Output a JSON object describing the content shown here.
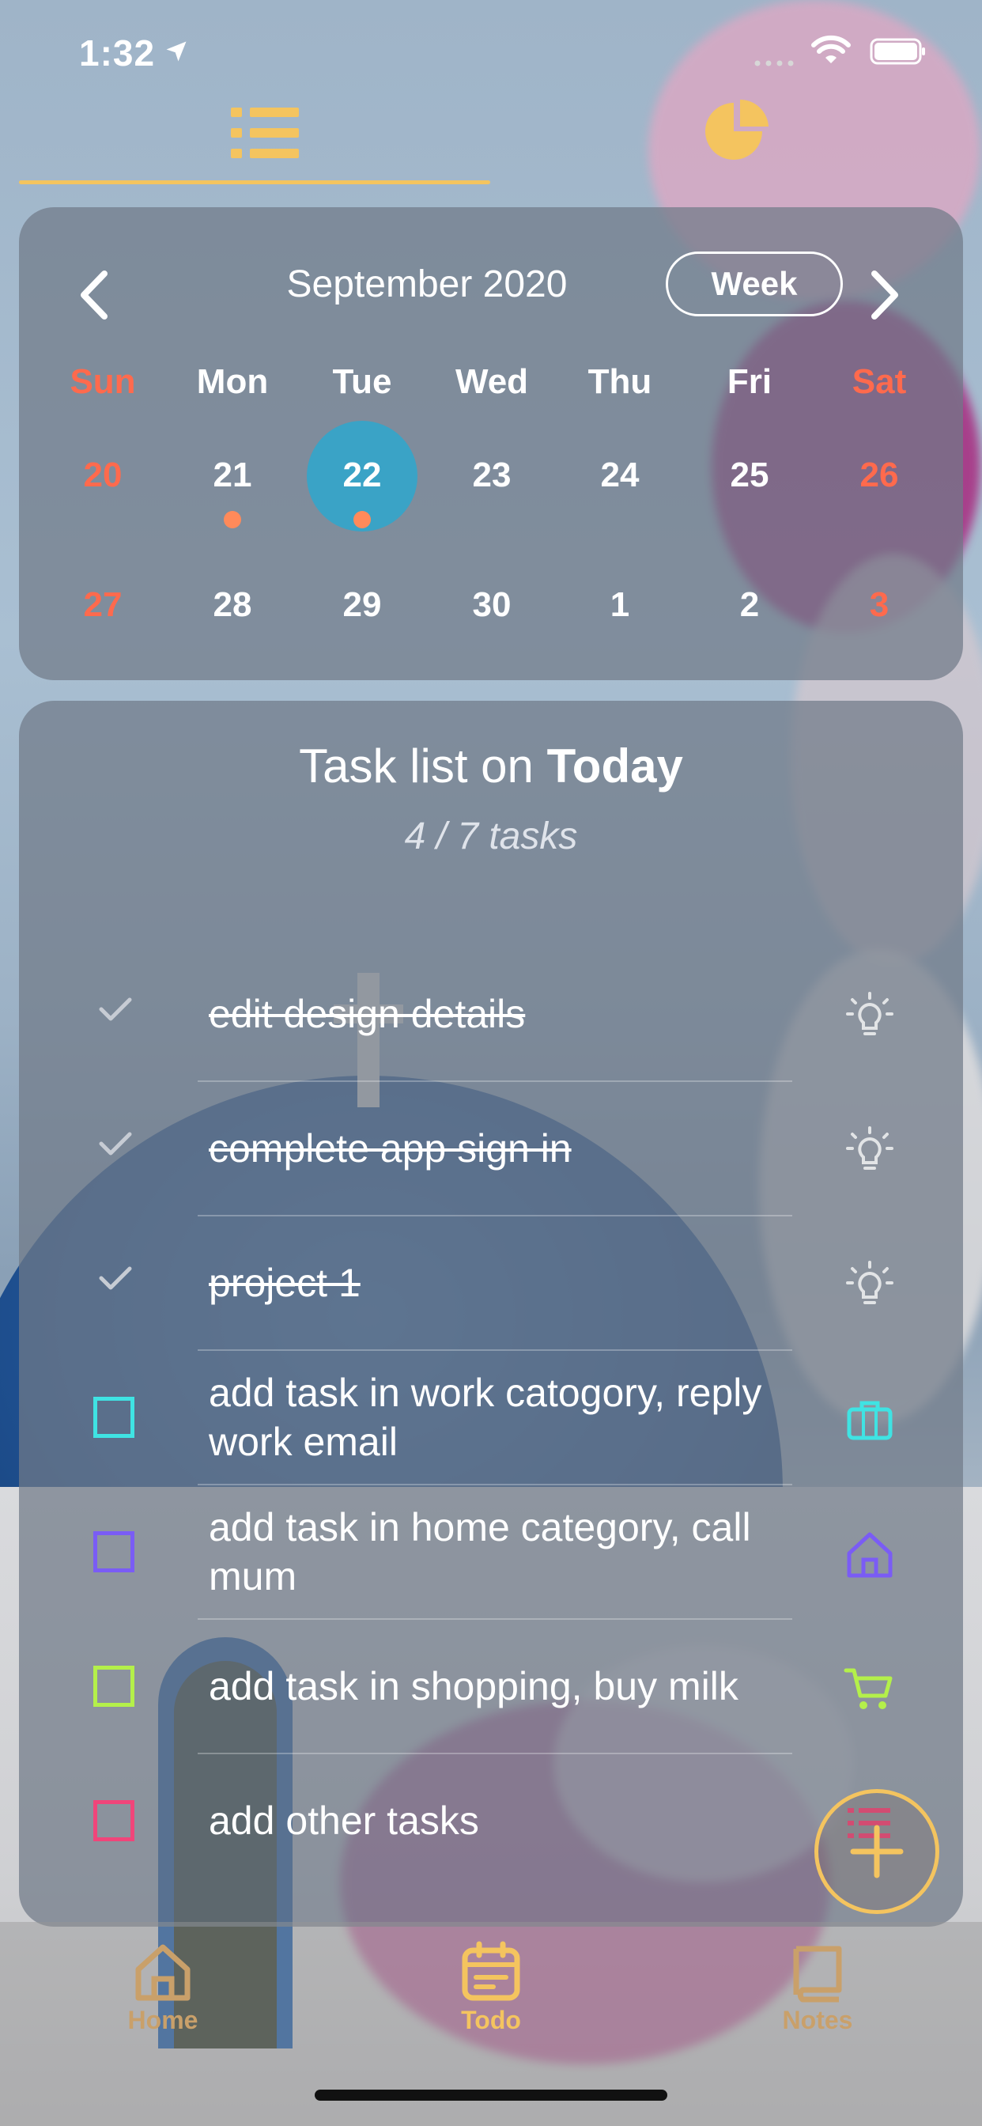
{
  "status_bar": {
    "time": "1:32"
  },
  "top_tabs": {
    "active": "list"
  },
  "calendar": {
    "month_label": "September 2020",
    "view_button": "Week",
    "weekdays": [
      "Sun",
      "Mon",
      "Tue",
      "Wed",
      "Thu",
      "Fri",
      "Sat"
    ],
    "week1": [
      "20",
      "21",
      "22",
      "23",
      "24",
      "25",
      "26"
    ],
    "week2": [
      "27",
      "28",
      "29",
      "30",
      "1",
      "2",
      "3"
    ],
    "selected_day": "22",
    "days_with_tasks": [
      "21",
      "22"
    ]
  },
  "tasks": {
    "title_prefix": "Task list on ",
    "title_day": "Today",
    "count": "4 / 7 tasks",
    "items": [
      {
        "text": "edit design details",
        "done": true,
        "category": "lightbulb-icon"
      },
      {
        "text": "complete app sign in",
        "done": true,
        "category": "lightbulb-icon"
      },
      {
        "text": "project 1",
        "done": true,
        "category": "lightbulb-icon"
      },
      {
        "text": "add task in work catogory, reply work email",
        "done": false,
        "category": "briefcase-icon",
        "color": "#3fe3e3"
      },
      {
        "text": "add task in home category, call mum",
        "done": false,
        "category": "home-icon",
        "color": "#7a5cf5"
      },
      {
        "text": "add task in shopping, buy milk",
        "done": false,
        "category": "cart-icon",
        "color": "#b4f04a"
      },
      {
        "text": "add other tasks",
        "done": false,
        "category": "list-icon",
        "color": "#f0457a"
      }
    ]
  },
  "bottom_nav": {
    "items": [
      {
        "label": "Home",
        "icon": "home-icon",
        "active": false
      },
      {
        "label": "Todo",
        "icon": "calendar-icon",
        "active": true
      },
      {
        "label": "Notes",
        "icon": "book-icon",
        "active": false
      }
    ]
  },
  "colors": {
    "accent": "#f4c45f",
    "weekend": "#ff6a4d",
    "selected_day": "#3aa3c6",
    "task_dot": "#ff8a5a"
  }
}
